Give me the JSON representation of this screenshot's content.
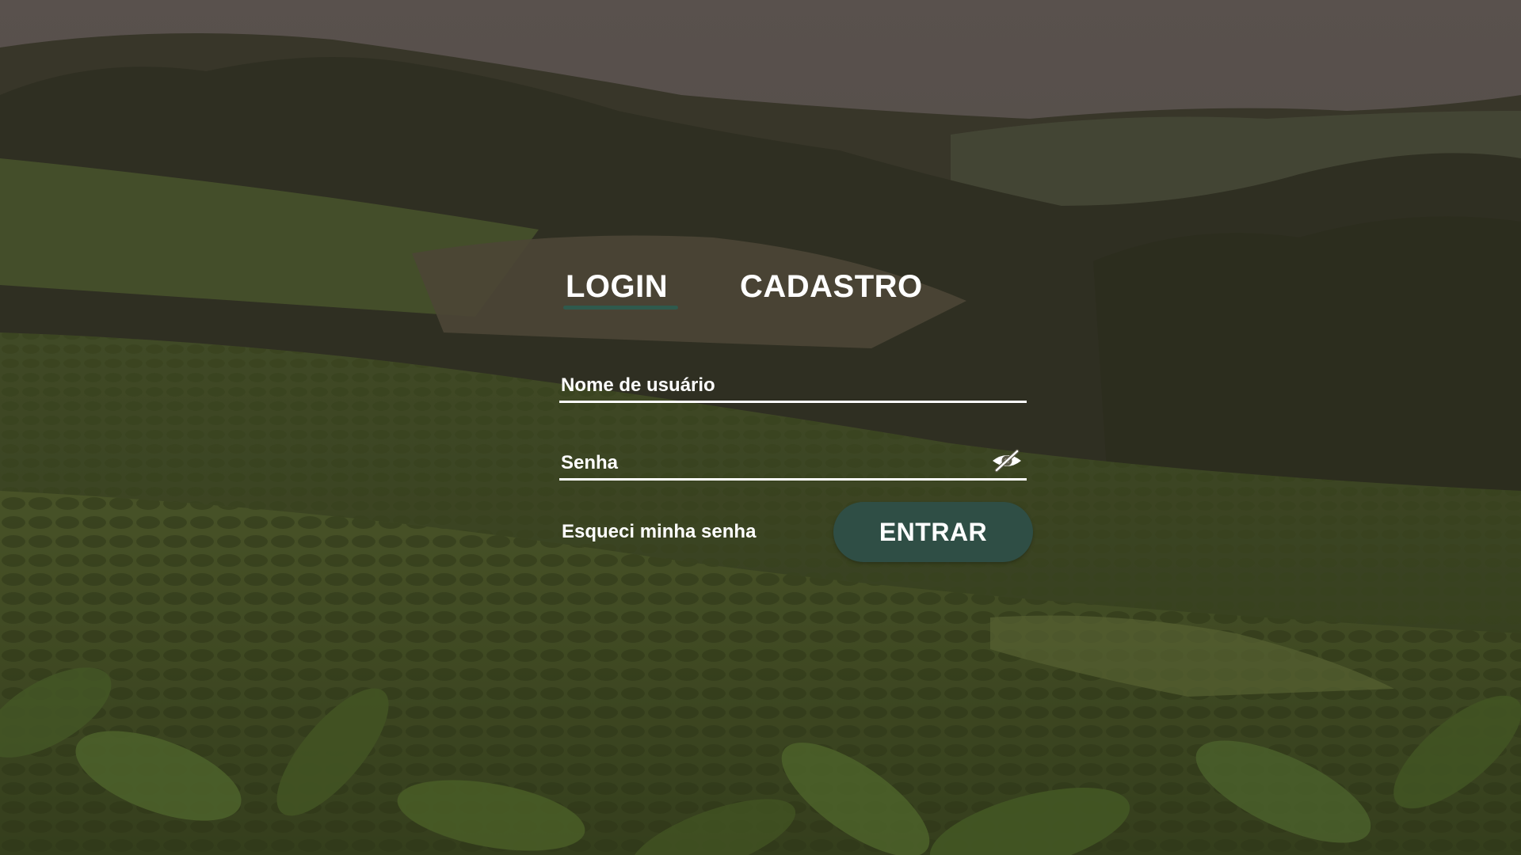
{
  "colors": {
    "accent": "#2f4e45",
    "tab_underline": "#2f5a4d",
    "text": "#ffffff",
    "field_line": "#ffffff"
  },
  "background": {
    "scene": "coffee-plantation-hills",
    "icon": "background-image"
  },
  "tabs": [
    {
      "label": "LOGIN",
      "active": true
    },
    {
      "label": "CADASTRO",
      "active": false
    }
  ],
  "form": {
    "username": {
      "value": "",
      "placeholder": "Nome de usuário"
    },
    "password": {
      "value": "",
      "placeholder": "Senha",
      "toggle_icon": "eye-slash-icon"
    },
    "forgot_label": "Esqueci minha senha",
    "submit_label": "ENTRAR"
  }
}
